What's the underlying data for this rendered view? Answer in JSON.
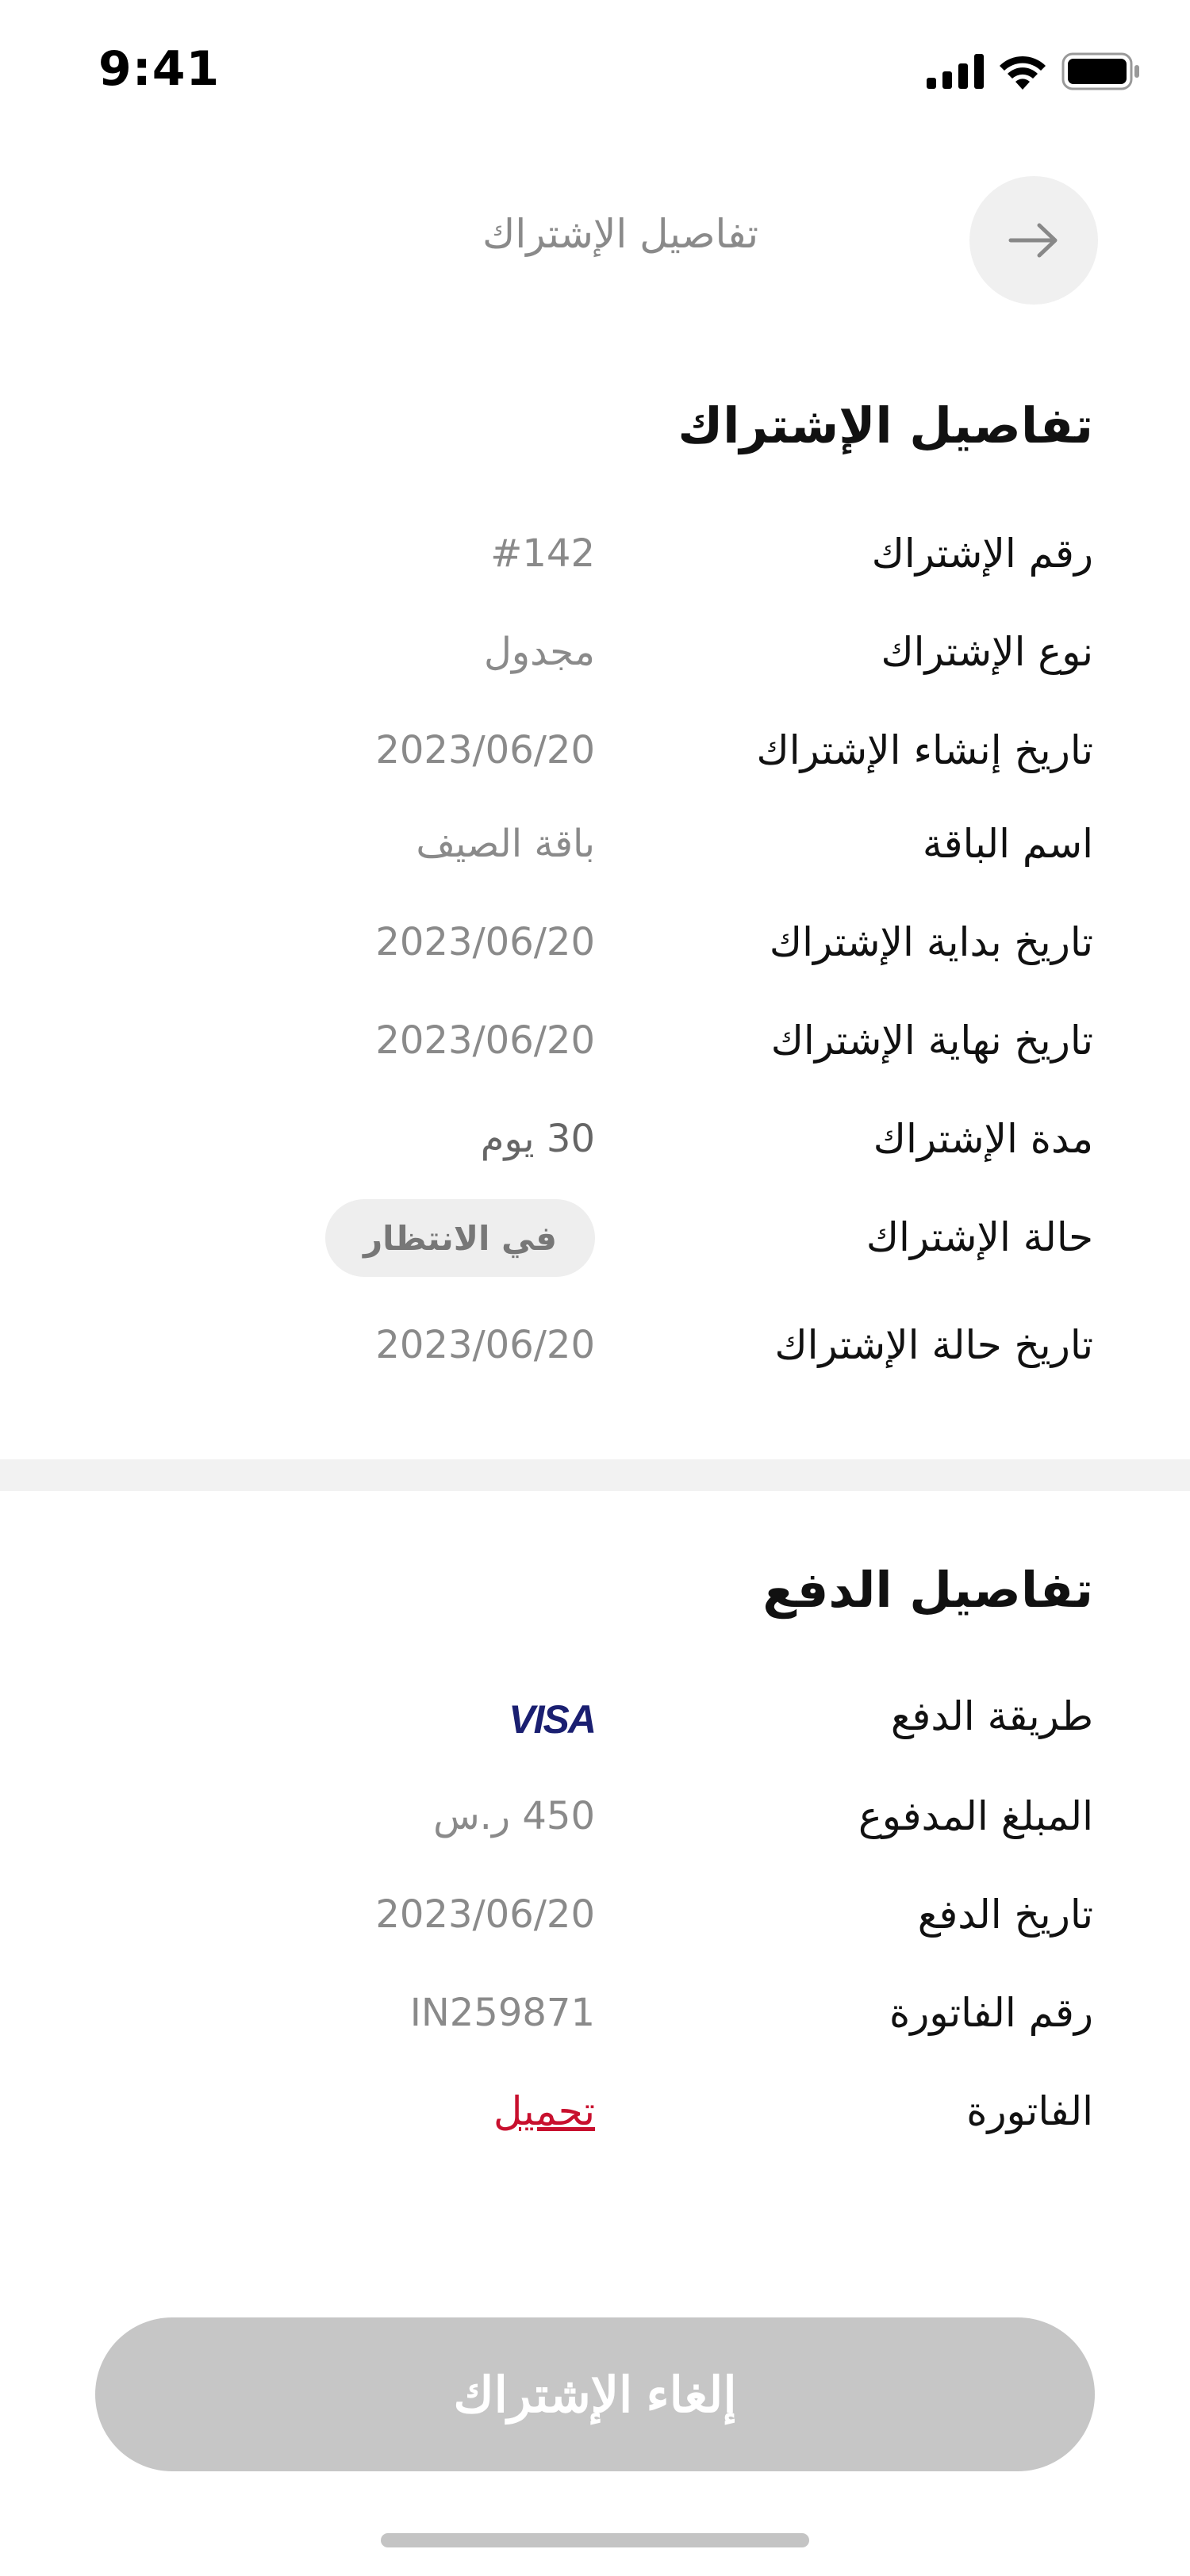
{
  "status_bar": {
    "time": "9:41"
  },
  "header": {
    "title": "تفاصيل الإشتراك",
    "back_icon": "arrow-right-icon"
  },
  "subscription": {
    "section_title": "تفاصيل الإشتراك",
    "rows": [
      {
        "label": "رقم الإشتراك",
        "value": "#142"
      },
      {
        "label": "نوع الإشتراك",
        "value": "مجدول"
      },
      {
        "label": "تاريخ إنشاء الإشتراك",
        "value": "2023/06/20"
      },
      {
        "label": "اسم الباقة",
        "value": "باقة الصيف"
      },
      {
        "label": "تاريخ بداية الإشتراك",
        "value": "2023/06/20"
      },
      {
        "label": "تاريخ نهاية الإشتراك",
        "value": "2023/06/20"
      },
      {
        "label": "مدة الإشتراك",
        "value": "30 يوم"
      },
      {
        "label": "حالة الإشتراك",
        "value": "في الانتظار"
      },
      {
        "label": "تاريخ حالة الإشتراك",
        "value": "2023/06/20"
      }
    ]
  },
  "payment": {
    "section_title": "تفاصيل الدفع",
    "rows": [
      {
        "label": "طريقة الدفع",
        "value": "VISA"
      },
      {
        "label": "المبلغ المدفوع",
        "value": "450 ر.س"
      },
      {
        "label": "تاريخ الدفع",
        "value": "2023/06/20"
      },
      {
        "label": "رقم الفاتورة",
        "value": "IN259871"
      },
      {
        "label": "الفاتورة",
        "value": "تحميل"
      }
    ]
  },
  "cancel_button": {
    "label": "إلغاء الإشتراك"
  },
  "colors": {
    "link": "#c8102e",
    "visa": "#1a1f71",
    "muted": "#8a8a8a",
    "button_disabled": "#c6c6c6"
  }
}
